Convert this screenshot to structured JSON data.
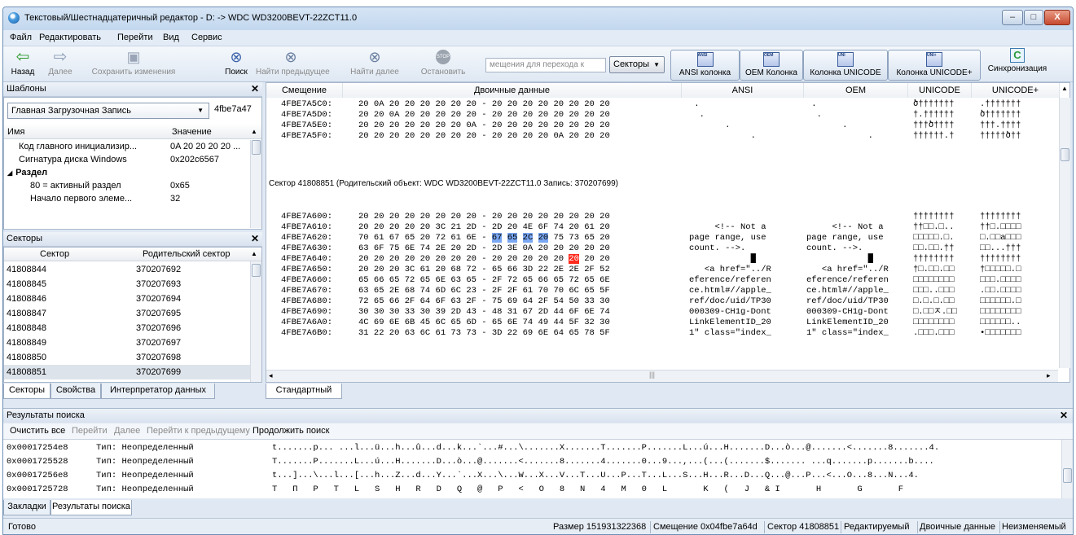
{
  "app": {
    "title": "Текстовый/Шестнадцатеричный редактор - D: -> WDC WD3200BEVT-22ZCT11.0",
    "window_controls": [
      "–",
      "□",
      "X"
    ]
  },
  "menu": [
    "Файл",
    "Редактировать",
    "Перейти",
    "Вид",
    "Сервис"
  ],
  "toolbar": {
    "back": "Назад",
    "forward": "Далее",
    "save": "Сохранить изменения",
    "search": "Поиск",
    "find_prev": "Найти предыдущее",
    "find_next": "Найти далее",
    "stop": "Остановить",
    "stop_icon_text": "STOP",
    "goto_placeholder": "мещения для перехода к",
    "sectors_dropdown": "Секторы",
    "ansi_col": "ANSI колонка",
    "oem_col": "OEM Колонка",
    "unicode_col": "Колонка UNICODE",
    "unicode_plus_col": "Колонка UNICODE+",
    "sync": "Синхронизация",
    "icon_labels": [
      "ANSI",
      "OEM",
      "UNI",
      "UNI+"
    ]
  },
  "templates_panel": {
    "title": "Шаблоны",
    "combo_value": "Главная Загрузочная Запись",
    "combo_offset": "4fbe7a47",
    "col_name": "Имя",
    "col_value": "Значение",
    "rows": [
      {
        "name": "Код главного инициализир...",
        "value": "0A 20 20 20 20 ..."
      },
      {
        "name": "Сигнатура диска Windows",
        "value": "0x202c6567"
      },
      {
        "name": "Раздел",
        "value": ""
      },
      {
        "name": "80 = активный раздел",
        "value": "0x65"
      },
      {
        "name": "Начало первого элеме...",
        "value": "32"
      }
    ]
  },
  "sectors_panel": {
    "title": "Секторы",
    "col_sector": "Сектор",
    "col_parent": "Родительский сектор",
    "rows": [
      {
        "sector": "41808844",
        "parent": "370207692"
      },
      {
        "sector": "41808845",
        "parent": "370207693"
      },
      {
        "sector": "41808846",
        "parent": "370207694"
      },
      {
        "sector": "41808847",
        "parent": "370207695"
      },
      {
        "sector": "41808848",
        "parent": "370207696"
      },
      {
        "sector": "41808849",
        "parent": "370207697"
      },
      {
        "sector": "41808850",
        "parent": "370207698"
      },
      {
        "sector": "41808851",
        "parent": "370207699"
      }
    ],
    "tabs": [
      "Секторы",
      "Свойства",
      "Интерпретатор данных"
    ]
  },
  "hex": {
    "headers": [
      "Смещение",
      "Двоичные данные",
      "ANSI",
      "OEM",
      "UNICODE",
      "UNICODE+"
    ],
    "top_rows": [
      {
        "offset": "4FBE7A5C0:",
        "bytes": "20 0A 20 20 20 20 20 20 - 20 20 20 20 20 20 20 20",
        "ansi": " .",
        "oem": " .",
        "uni": "ծ†††††††",
        "unip": ".†††††††"
      },
      {
        "offset": "4FBE7A5D0:",
        "bytes": "20 20 0A 20 20 20 20 20 - 20 20 20 20 20 20 20 20",
        "ansi": "  .",
        "oem": "  .",
        "uni": "†.††††††",
        "unip": "ծ†††††††"
      },
      {
        "offset": "4FBE7A5E0:",
        "bytes": "20 20 20 20 20 20 20 0A - 20 20 20 20 20 20 20 20",
        "ansi": "       .",
        "oem": "       .",
        "uni": "†††ծ††††",
        "unip": "†††.††††"
      },
      {
        "offset": "4FBE7A5F0:",
        "bytes": "20 20 20 20 20 20 20 20 - 20 20 20 20 0A 20 20 20",
        "ansi": "            .",
        "oem": "            .",
        "uni": "††††††.†",
        "unip": "†††††ծ††"
      }
    ],
    "sector_separator": "Сектор 41808851 (Родительский объект: WDC WD3200BEVT-22ZCT11.0 Запись: 370207699)",
    "rows": [
      {
        "offset": "4FBE7A600:",
        "bytes": "20 20 20 20 20 20 20 20 - 20 20 20 20 20 20 20 20",
        "ansi": "",
        "oem": "",
        "uni": "††††††††",
        "unip": "††††††††"
      },
      {
        "offset": "4FBE7A610:",
        "bytes": "20 20 20 20 20 3C 21 2D - 2D 20 4E 6F 74 20 61 20",
        "ansi": "     <!-- Not a ",
        "oem": "     <!-- Not a ",
        "uni": "††□□.□..",
        "unip": "††□.□□□□"
      },
      {
        "offset": "4FBE7A620:",
        "bytes": "70 61 67 65 20 72 61 6E - 67 65 2C 20 75 73 65 20",
        "ansi": "page range, use ",
        "oem": "page range, use ",
        "uni": "□□□□□.□.",
        "unip": "□.□□a□□□"
      },
      {
        "offset": "4FBE7A630:",
        "bytes": "63 6F 75 6E 74 2E 20 2D - 2D 3E 0A 20 20 20 20 20",
        "ansi": "count. -->.     ",
        "oem": "count. -->.     ",
        "uni": "□□.□□.††",
        "unip": "□□...†††"
      },
      {
        "offset": "4FBE7A640:",
        "bytes": "20 20 20 20 20 20 20 20 - 20 20 20 20 20 20 20 20",
        "ansi": "            █   ",
        "oem": "            █   ",
        "uni": "††††††††",
        "unip": "††††††††"
      },
      {
        "offset": "4FBE7A650:",
        "bytes": "20 20 20 3C 61 20 68 72 - 65 66 3D 22 2E 2E 2F 52",
        "ansi": "   <a href=\"../R",
        "oem": "   <a href=\"../R",
        "uni": "†□.□□.□□",
        "unip": "†□□□□□.□"
      },
      {
        "offset": "4FBE7A660:",
        "bytes": "65 66 65 72 65 6E 63 65 - 2F 72 65 66 65 72 65 6E",
        "ansi": "eference/referen",
        "oem": "eference/referen",
        "uni": "□□□□□□□□",
        "unip": "□□□.□□□□"
      },
      {
        "offset": "4FBE7A670:",
        "bytes": "63 65 2E 68 74 6D 6C 23 - 2F 2F 61 70 70 6C 65 5F",
        "ansi": "ce.html#//apple_",
        "oem": "ce.html#//apple_",
        "uni": "□□□..□□□",
        "unip": ".□□.□□□□"
      },
      {
        "offset": "4FBE7A680:",
        "bytes": "72 65 66 2F 64 6F 63 2F - 75 69 64 2F 54 50 33 30",
        "ansi": "ref/doc/uid/TP30",
        "oem": "ref/doc/uid/TP30",
        "uni": "□.□.□.□□",
        "unip": "□□□□□□.□"
      },
      {
        "offset": "4FBE7A690:",
        "bytes": "30 30 30 33 30 39 2D 43 - 48 31 67 2D 44 6F 6E 74",
        "ansi": "000309-CH1g-Dont",
        "oem": "000309-CH1g-Dont",
        "uni": "□.□□ㅈ.□□",
        "unip": "□□□□□□□□"
      },
      {
        "offset": "4FBE7A6A0:",
        "bytes": "4C 69 6E 6B 45 6C 65 6D - 65 6E 74 49 44 5F 32 30",
        "ansi": "LinkElementID_20",
        "oem": "LinkElementID_20",
        "uni": "□□□□□□□□",
        "unip": "□□□□□□.."
      },
      {
        "offset": "4FBE7A6B0:",
        "bytes": "31 22 20 63 6C 61 73 73 - 3D 22 69 6E 64 65 78 5F",
        "ansi": "1\" class=\"index_",
        "oem": "1\" class=\"index_",
        "uni": ".□□□.□□□",
        "unip": "•□□□□□□□"
      }
    ],
    "tab": "Стандартный"
  },
  "search": {
    "title": "Результаты поиска",
    "clear": "Очистить все",
    "goto": "Перейти",
    "next": "Далее",
    "prev": "Перейти к предыдущему",
    "continue": "Продолжить поиск",
    "rows": [
      {
        "addr": "0x00017254e8",
        "type": "Тип: Неопределенный",
        "text": "t.......p... ...l...ü...h...û...d...k...`...#...\\.......X.......T.......P.......L...ú...H.......D...ò...@.......<.......8.......4."
      },
      {
        "addr": "0x0001725528",
        "type": "Тип: Неопределенный",
        "text": "T.......P.......L...ú...H.......D...ò...@.......<.......8.......4.......0...9...,...(...(.......$....... ...q.......p.......b...."
      },
      {
        "addr": "0x00017256e8",
        "type": "Тип: Неопределенный",
        "text": "t...]...\\...l...[...h...Z...d...Y...`...X...\\...W...X...V...T...U...P...T...L...S...H...R...D...Q...@...P...<...O...8...N...4."
      },
      {
        "addr": "0x0001725728",
        "type": "Тип: Неопределенный",
        "text": "T   П   P   T   L   S   H   R   D   Q   @   P   <   O   8   N   4   M   0   L       K   (   J   & I       H       G       F"
      }
    ],
    "tabs": [
      "Закладки",
      "Результаты поиска"
    ]
  },
  "status": {
    "ready": "Готово",
    "size": "Размер 151931322368",
    "offset": "Смещение 0x04fbe7a64d",
    "sector": "Сектор 41808851",
    "editable": "Редактируемый",
    "binary": "Двоичные данные",
    "unchanged": "Неизменяемый"
  }
}
